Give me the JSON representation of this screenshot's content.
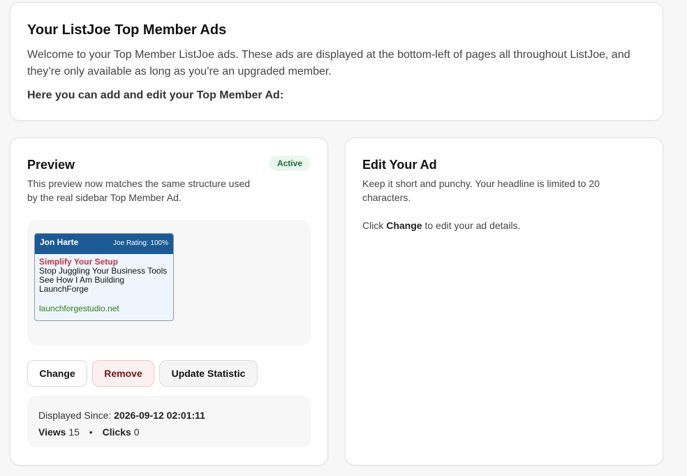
{
  "intro": {
    "title": "Your ListJoe Top Member Ads",
    "description": "Welcome to your Top Member ListJoe ads. These ads are displayed at the bottom-left of pages all throughout ListJoe, and they’re only available as long as you’re an upgraded member.",
    "cta": "Here you can add and edit your Top Member Ad:"
  },
  "preview": {
    "title": "Preview",
    "status": "Active",
    "subtitle": "This preview now matches the same structure used by the real sidebar Top Member Ad.",
    "ad": {
      "name": "Jon Harte",
      "rating": "Joe Rating: 100%",
      "headline": "Simplify Your Setup",
      "line1": "Stop Juggling Your Business Tools",
      "line2": "See How I Am Building",
      "line3": "LaunchForge",
      "url": "launchforgestudio.net"
    },
    "buttons": {
      "change": "Change",
      "remove": "Remove",
      "update": "Update Statistic"
    },
    "stats": {
      "since_label": "Displayed Since:",
      "since_value": "2026-09-12 02:01:11",
      "views_label": "Views",
      "views_value": "15",
      "separator": "•",
      "clicks_label": "Clicks",
      "clicks_value": "0"
    }
  },
  "edit": {
    "title": "Edit Your Ad",
    "subtitle": "Keep it short and punchy. Your headline is limited to 20 characters.",
    "hint_pre": "Click",
    "hint_strong": "Change",
    "hint_post": "to edit your ad details."
  },
  "colors": {
    "ad_header": "#1c5a96",
    "ad_headline": "#c0333f",
    "ad_url": "#2f7d1a",
    "badge_bg": "#eaf7ee",
    "badge_text": "#1e6b37",
    "remove_bg": "#fdf0f0",
    "remove_text": "#6e1515"
  }
}
